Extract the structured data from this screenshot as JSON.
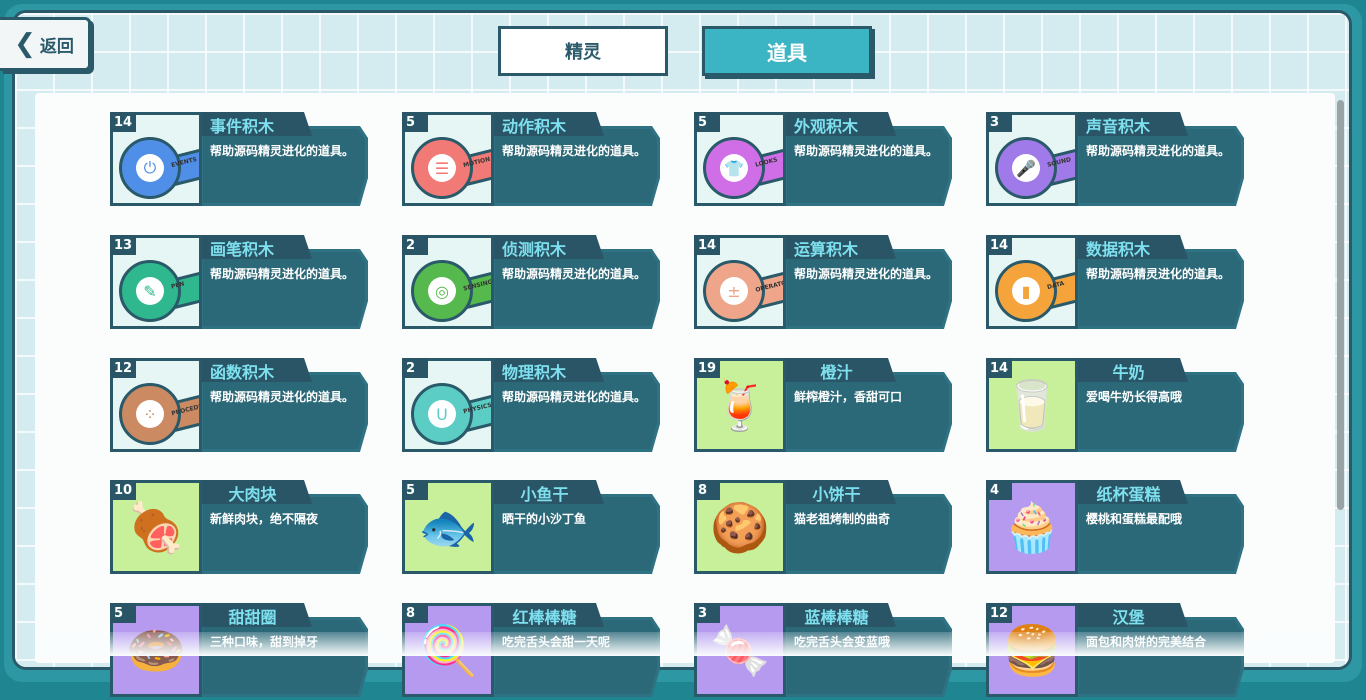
{
  "header": {
    "back_label": "返回",
    "tabs": [
      {
        "label": "精灵",
        "active": false
      },
      {
        "label": "道具",
        "active": true
      }
    ]
  },
  "items": [
    {
      "count": "14",
      "name": "事件积木",
      "desc": "帮助源码精灵进化的道具。",
      "kind": "block",
      "color": "#4f8fe8",
      "glyph": "⏻",
      "word": "EVENTS"
    },
    {
      "count": "5",
      "name": "动作积木",
      "desc": "帮助源码精灵进化的道具。",
      "kind": "block",
      "color": "#f27a76",
      "glyph": "☰",
      "word": "MOTION"
    },
    {
      "count": "5",
      "name": "外观积木",
      "desc": "帮助源码精灵进化的道具。",
      "kind": "block",
      "color": "#cf6ee6",
      "glyph": "👕",
      "word": "LOOKS"
    },
    {
      "count": "3",
      "name": "声音积木",
      "desc": "帮助源码精灵进化的道具。",
      "kind": "block",
      "color": "#a07ae8",
      "glyph": "🎤",
      "word": "SOUND"
    },
    {
      "count": "13",
      "name": "画笔积木",
      "desc": "帮助源码精灵进化的道具。",
      "kind": "block",
      "color": "#2fb88e",
      "glyph": "✎",
      "word": "PEN"
    },
    {
      "count": "2",
      "name": "侦测积木",
      "desc": "帮助源码精灵进化的道具。",
      "kind": "block",
      "color": "#56b94d",
      "glyph": "◎",
      "word": "SENSING"
    },
    {
      "count": "14",
      "name": "运算积木",
      "desc": "帮助源码精灵进化的道具。",
      "kind": "block",
      "color": "#eea58a",
      "glyph": "±",
      "word": "OPERATORS"
    },
    {
      "count": "14",
      "name": "数据积木",
      "desc": "帮助源码精灵进化的道具。",
      "kind": "block",
      "color": "#f5a43c",
      "glyph": "▮",
      "word": "DATA"
    },
    {
      "count": "12",
      "name": "函数积木",
      "desc": "帮助源码精灵进化的道具。",
      "kind": "block",
      "color": "#cc8a62",
      "glyph": "⁘",
      "word": "PROCEDURES"
    },
    {
      "count": "2",
      "name": "物理积木",
      "desc": "帮助源码精灵进化的道具。",
      "kind": "block",
      "color": "#5ccdc4",
      "glyph": "U",
      "word": "PHYSICS"
    },
    {
      "count": "19",
      "name": "橙汁",
      "desc": "鲜榨橙汁，香甜可口",
      "kind": "food",
      "color": "#c8f09a",
      "glyph": "🍹"
    },
    {
      "count": "14",
      "name": "牛奶",
      "desc": "爱喝牛奶长得高哦",
      "kind": "food",
      "color": "#c8f09a",
      "glyph": "🥛"
    },
    {
      "count": "10",
      "name": "大肉块",
      "desc": "新鲜肉块，绝不隔夜",
      "kind": "food",
      "color": "#c8f09a",
      "glyph": "🍖"
    },
    {
      "count": "5",
      "name": "小鱼干",
      "desc": "晒干的小沙丁鱼",
      "kind": "food",
      "color": "#c8f09a",
      "glyph": "🐟"
    },
    {
      "count": "8",
      "name": "小饼干",
      "desc": "猫老祖烤制的曲奇",
      "kind": "food",
      "color": "#c8f09a",
      "glyph": "🍪"
    },
    {
      "count": "4",
      "name": "纸杯蛋糕",
      "desc": "樱桃和蛋糕最配哦",
      "kind": "food",
      "color": "#b59af0",
      "glyph": "🧁"
    },
    {
      "count": "5",
      "name": "甜甜圈",
      "desc": "三种口味，甜到掉牙",
      "kind": "food",
      "color": "#b59af0",
      "glyph": "🍩"
    },
    {
      "count": "8",
      "name": "红棒棒糖",
      "desc": "吃完舌头会甜一天呢",
      "kind": "food",
      "color": "#b59af0",
      "glyph": "🍭"
    },
    {
      "count": "3",
      "name": "蓝棒棒糖",
      "desc": "吃完舌头会变蓝哦",
      "kind": "food",
      "color": "#b59af0",
      "glyph": "🍬"
    },
    {
      "count": "12",
      "name": "汉堡",
      "desc": "面包和肉饼的完美结合",
      "kind": "food",
      "color": "#b59af0",
      "glyph": "🍔"
    }
  ]
}
